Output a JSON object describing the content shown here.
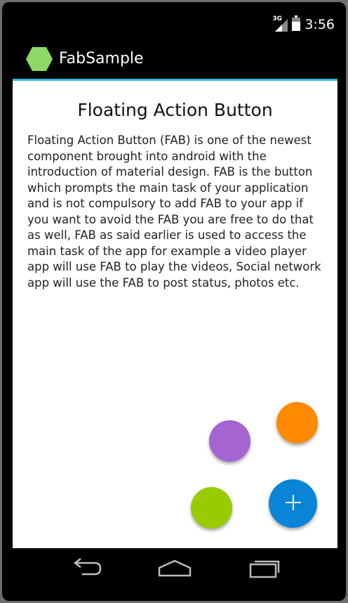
{
  "status_bar": {
    "network_label": "3G",
    "time": "3:56"
  },
  "action_bar": {
    "app_icon": "hexagon-app-icon",
    "app_title": "FabSample"
  },
  "content": {
    "title": "Floating Action Button",
    "body": "Floating Action Button (FAB) is one of the newest component brought into android with the introduction of material design. FAB is the button which prompts the main task of your application and is not compulsory to add FAB to your app if you want to avoid the FAB you are free to do that as well, FAB as said earlier is used to access the main task of the app for example a video player app will use FAB to play the videos, Social network app will use the FAB to post status, photos etc."
  },
  "fabs": [
    {
      "name": "purple",
      "color": "#a565d1"
    },
    {
      "name": "orange",
      "color": "#ff8a00"
    },
    {
      "name": "green",
      "color": "#99cc00"
    },
    {
      "name": "main",
      "color": "#0a84d6",
      "icon": "plus-icon"
    }
  ],
  "colors": {
    "accent_line": "#33b5e5",
    "app_icon": "#8ed867"
  },
  "nav_bar": {
    "buttons": [
      "back-icon",
      "home-icon",
      "recents-icon"
    ]
  }
}
